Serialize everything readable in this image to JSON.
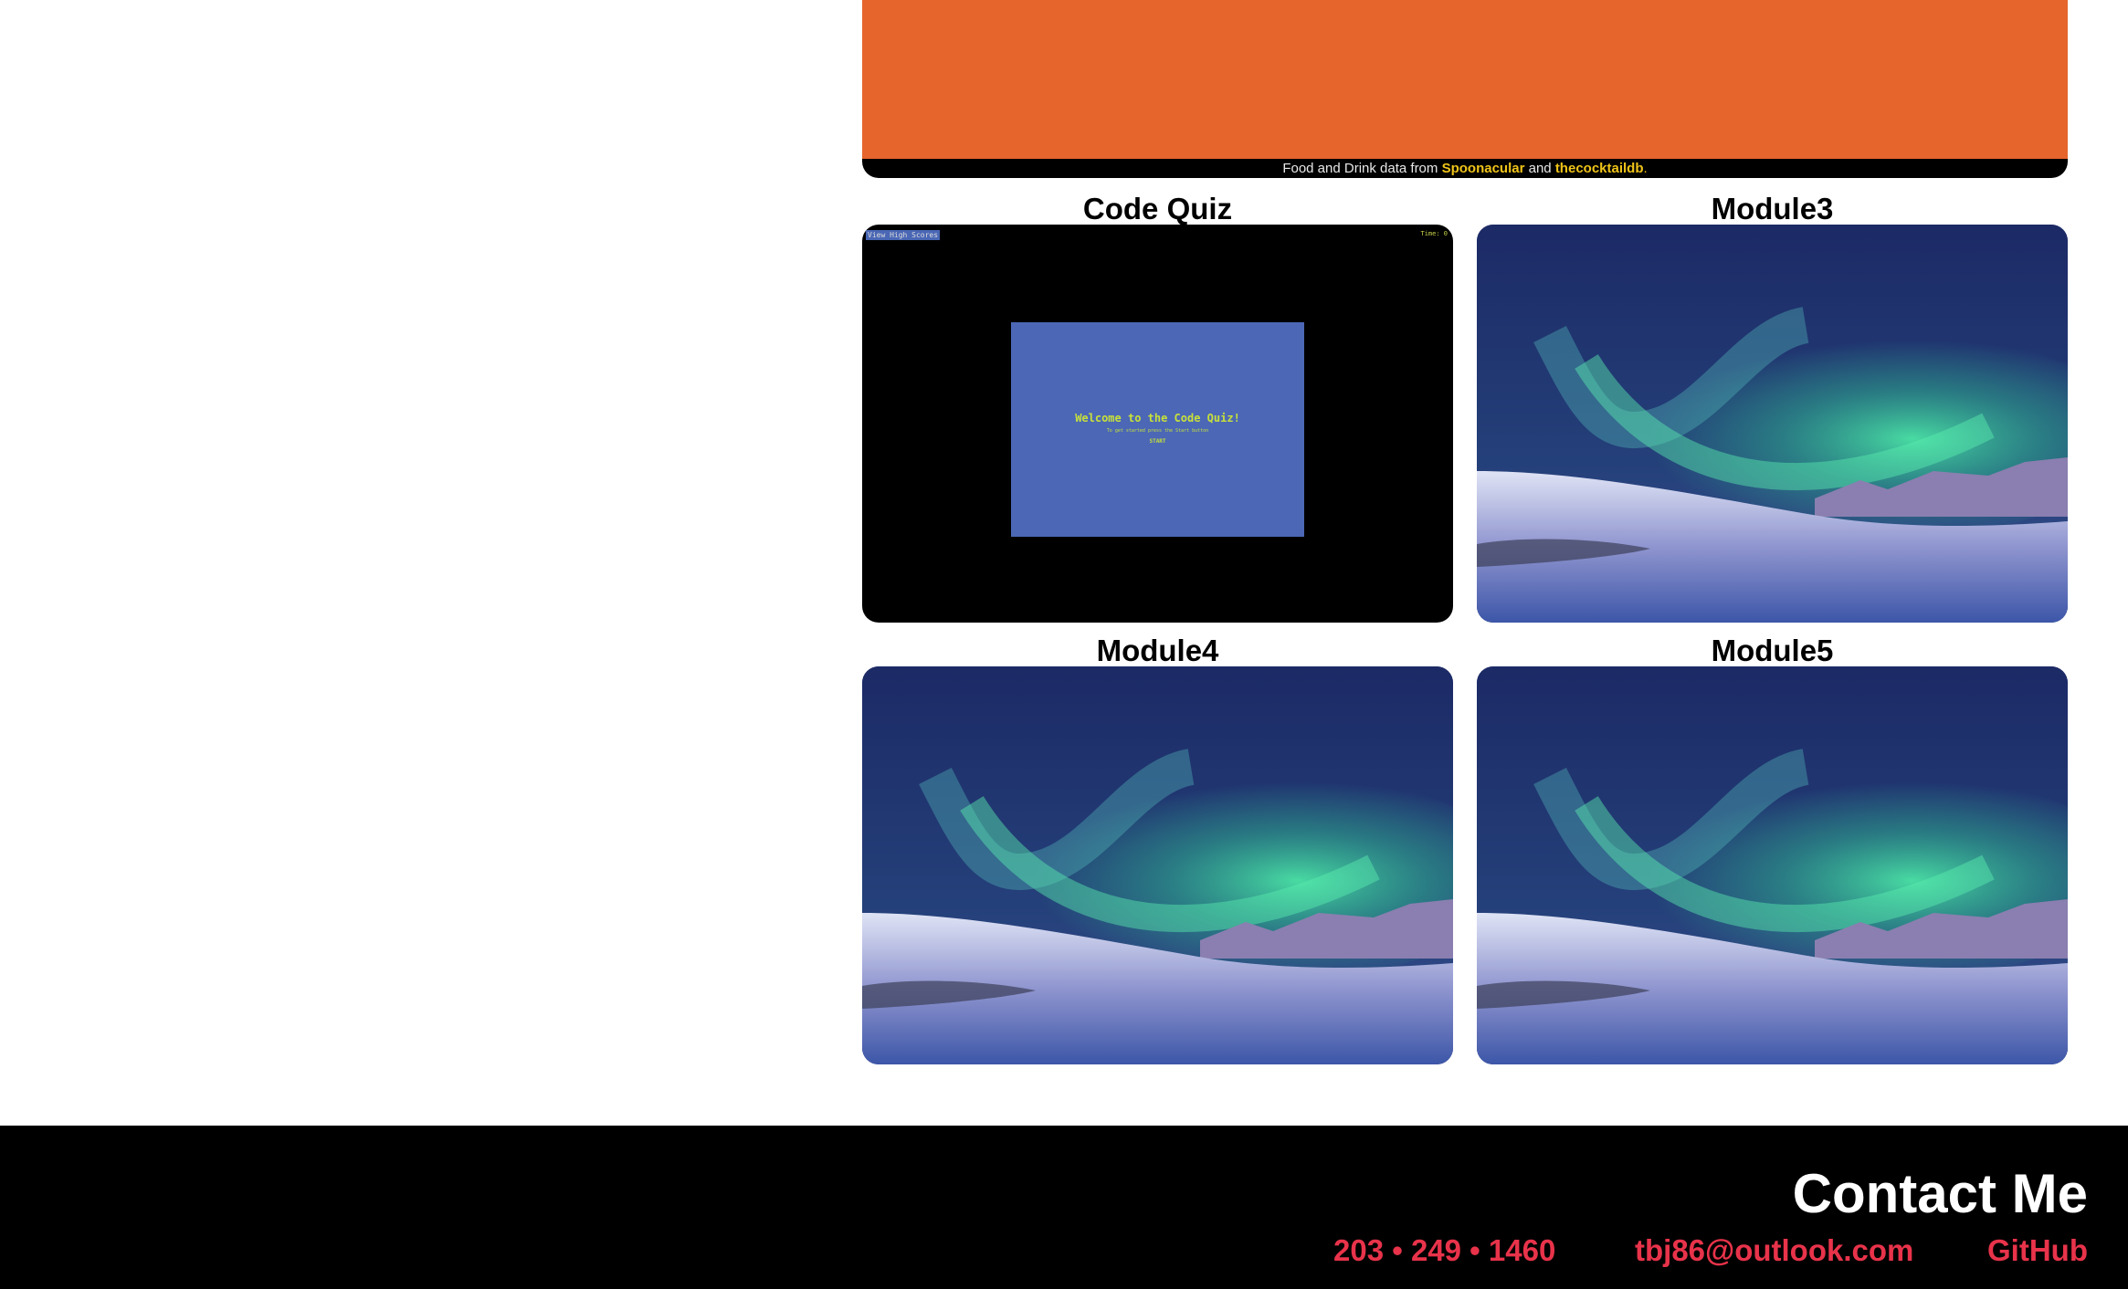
{
  "top_card": {
    "accent_color": "#e5652d",
    "credit_prefix": "Food and Drink data from",
    "credit_link1": "Spoonacular",
    "credit_mid": "and",
    "credit_link2": "thecocktaildb",
    "credit_suffix": "."
  },
  "projects": [
    {
      "title": "Code Quiz",
      "screenshot": {
        "high_scores": "View High Scores",
        "timer": "Time: 0",
        "welcome": "Welcome to the Code Quiz!",
        "hint": "To get started press the Start button",
        "start": "START"
      }
    },
    {
      "title": "Module3"
    },
    {
      "title": "Module4"
    },
    {
      "title": "Module5"
    }
  ],
  "footer": {
    "heading": "Contact Me",
    "phone": "203 • 249 • 1460",
    "email": "tbj86@outlook.com",
    "github": "GitHub",
    "link_color": "#e8334a"
  }
}
